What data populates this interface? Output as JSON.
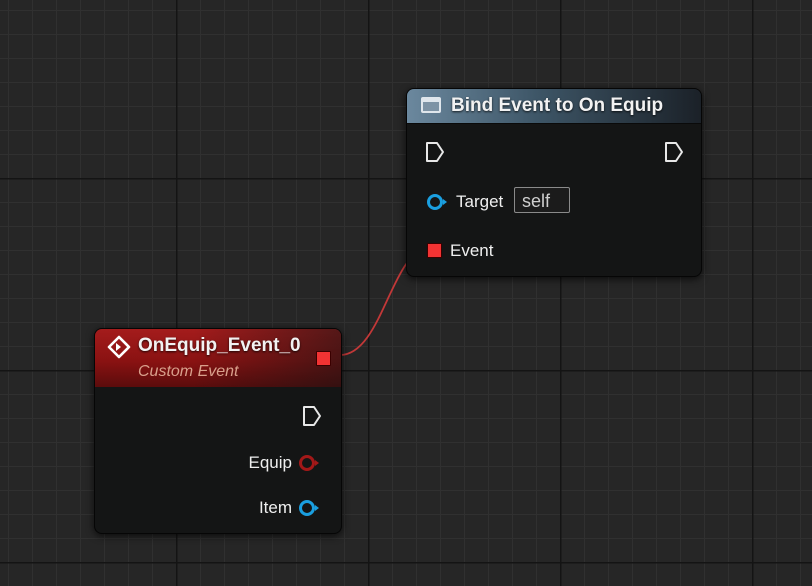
{
  "canvas": {
    "background": "#262626"
  },
  "bind_node": {
    "title": "Bind Event to On Equip",
    "header_color": "#6b889e",
    "exec_in_icon": "exec-arrow-icon",
    "exec_out_icon": "exec-arrow-icon",
    "target_label": "Target",
    "target_value": "self",
    "event_label": "Event"
  },
  "event_node": {
    "title": "OnEquip_Event_0",
    "subtitle": "Custom Event",
    "header_color": "#a41c1c",
    "pins": [
      {
        "label": "Equip",
        "color": "#a31818"
      },
      {
        "label": "Item",
        "color": "#1a9fe0"
      }
    ]
  },
  "colors": {
    "delegate": "#f23333",
    "object": "#1a9fe0",
    "wire": "#d23b3b"
  }
}
